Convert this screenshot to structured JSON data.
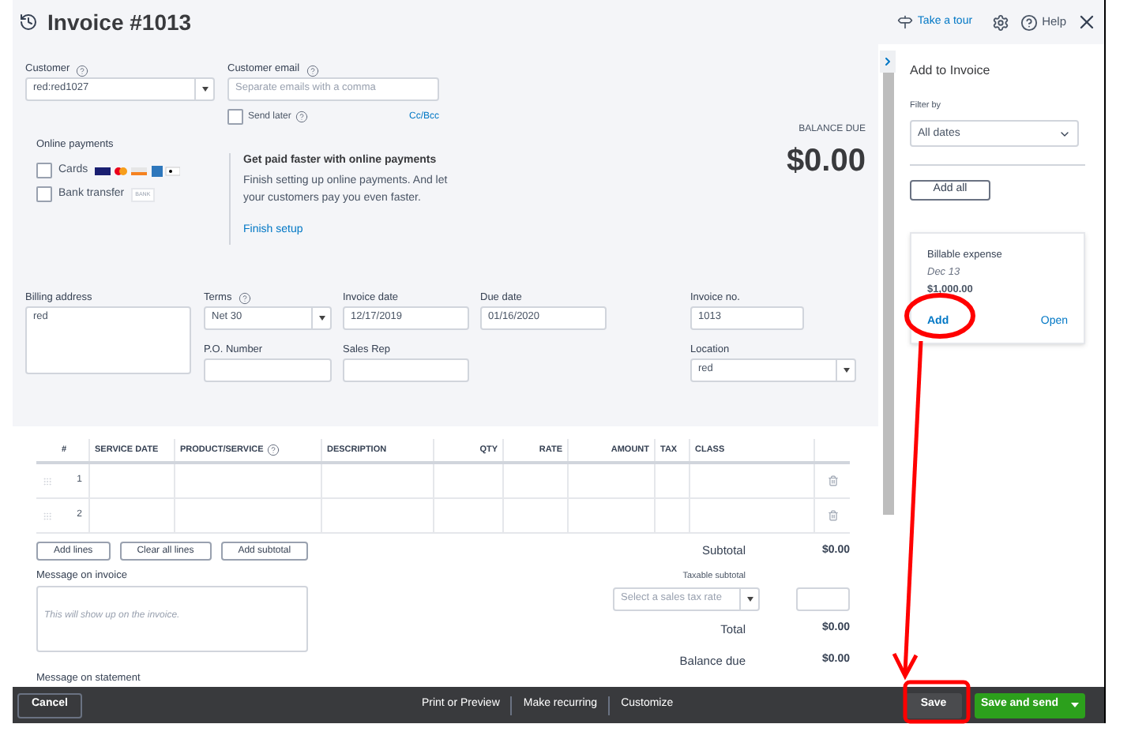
{
  "header": {
    "title": "Invoice #1013",
    "tour_link": "Take a tour",
    "help": "Help"
  },
  "customer": {
    "label": "Customer",
    "value": "red:red1027"
  },
  "email": {
    "label": "Customer email",
    "placeholder": "Separate emails with a comma",
    "cc_bcc": "Cc/Bcc"
  },
  "send_later": {
    "label": "Send later",
    "checked": false
  },
  "online_payments": {
    "title": "Online payments",
    "options": [
      {
        "label": "Cards",
        "checked": false,
        "kind": "cards"
      },
      {
        "label": "Bank transfer",
        "checked": false,
        "kind": "bank",
        "badge": "BANK"
      }
    ]
  },
  "promo": {
    "title": "Get paid faster with online payments",
    "text": "Finish setting up online payments. And let your customers pay you even faster.",
    "link": "Finish setup"
  },
  "balance": {
    "label": "BALANCE DUE",
    "amount": "$0.00"
  },
  "billing_address": {
    "label": "Billing address",
    "value": "red"
  },
  "terms": {
    "label": "Terms",
    "value": "Net 30"
  },
  "invoice_date": {
    "label": "Invoice date",
    "value": "12/17/2019"
  },
  "due_date": {
    "label": "Due date",
    "value": "01/16/2020"
  },
  "invoice_no": {
    "label": "Invoice no.",
    "value": "1013"
  },
  "po_number": {
    "label": "P.O. Number"
  },
  "sales_rep": {
    "label": "Sales Rep"
  },
  "location": {
    "label": "Location",
    "value": "red"
  },
  "table": {
    "columns": [
      "#",
      "SERVICE DATE",
      "PRODUCT/SERVICE",
      "DESCRIPTION",
      "QTY",
      "RATE",
      "AMOUNT",
      "TAX",
      "CLASS"
    ],
    "rows": [
      {
        "number": "1"
      },
      {
        "number": "2"
      }
    ]
  },
  "line_buttons": [
    "Add lines",
    "Clear all lines",
    "Add subtotal"
  ],
  "message_invoice": {
    "label": "Message on invoice",
    "placeholder": "This will show up on the invoice."
  },
  "message_statement": {
    "label": "Message on statement"
  },
  "totals": {
    "subtotal": {
      "label": "Subtotal",
      "value": "$0.00"
    },
    "taxable_label": "Taxable subtotal",
    "tax_placeholder": "Select a sales tax rate",
    "total": {
      "label": "Total",
      "value": "$0.00"
    },
    "balance_due": {
      "label": "Balance due",
      "value": "$0.00"
    }
  },
  "panel": {
    "title": "Add to Invoice",
    "filter_label": "Filter by",
    "filter_value": "All dates",
    "add_all": "Add all",
    "items": [
      {
        "title": "Billable expense",
        "date": "Dec 13",
        "amount": "$1,000.00",
        "add": "Add",
        "open": "Open"
      }
    ]
  },
  "footer": {
    "cancel": "Cancel",
    "actions": [
      "Print or Preview",
      "Make recurring",
      "Customize"
    ],
    "save": "Save",
    "save_send": "Save and send"
  }
}
